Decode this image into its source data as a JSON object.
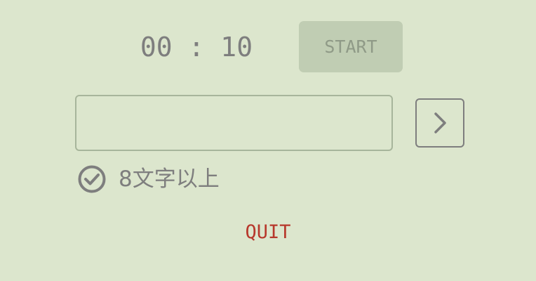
{
  "timer": {
    "display": "00 : 10"
  },
  "controls": {
    "start_label": "START",
    "quit_label": "QUIT"
  },
  "input": {
    "value": "",
    "placeholder": ""
  },
  "rules": [
    {
      "icon": "check-circle-icon",
      "label": "8文字以上"
    }
  ],
  "colors": {
    "background": "#dce6cd",
    "start_button_bg": "#c0cdb3",
    "text_gray": "#7e7e7e",
    "quit_red": "#b7382c"
  }
}
